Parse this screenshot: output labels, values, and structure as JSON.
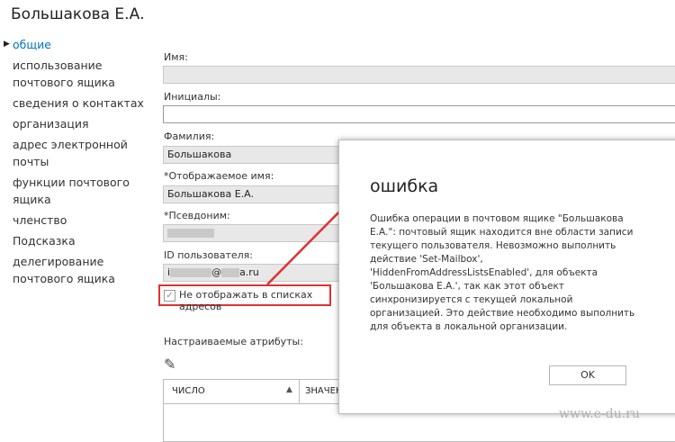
{
  "title": "Большакова Е.А.",
  "nav": {
    "items": [
      {
        "label": "общие"
      },
      {
        "label": "использование почтового ящика"
      },
      {
        "label": "сведения о контактах"
      },
      {
        "label": "организация"
      },
      {
        "label": "адрес электронной почты"
      },
      {
        "label": "функции почтового ящика"
      },
      {
        "label": "членство"
      },
      {
        "label": "Подсказка"
      },
      {
        "label": "делегирование почтового ящика"
      }
    ]
  },
  "form": {
    "name_label": "Имя:",
    "initials_label": "Инициалы:",
    "lastname_label": "Фамилия:",
    "lastname_value": "Большакова",
    "display_name_label": "*Отображаемое имя:",
    "display_name_value": "Большакова Е.А.",
    "alias_label": "*Псевдоним:",
    "user_id_label": "ID пользователя:",
    "user_id_value_start": "i",
    "user_id_value_middle": "@",
    "user_id_value_end": "a.ru",
    "hide_checkbox_label": "Не отображать в списках адресов",
    "custom_attrs_label": "Настраиваемые атрибуты:",
    "grid_col1": "ЧИСЛО",
    "grid_col2": "ЗНАЧЕН"
  },
  "dialog": {
    "title": "ошибка",
    "message": "Ошибка операции в почтовом ящике \"Большакова Е.А.\": почтовый ящик находится вне области записи текущего пользователя. Невозможно выполнить действие 'Set-Mailbox', 'HiddenFromAddressListsEnabled', для объекта 'Большакова Е.А.', так как этот объект синхронизируется с текущей локальной организацией. Это действие необходимо выполнить для объекта в локальной организации.",
    "ok_label": "OK"
  },
  "watermark": "www.e-du.ru",
  "colors": {
    "accent": "#0072c6",
    "highlight": "#e03131"
  }
}
